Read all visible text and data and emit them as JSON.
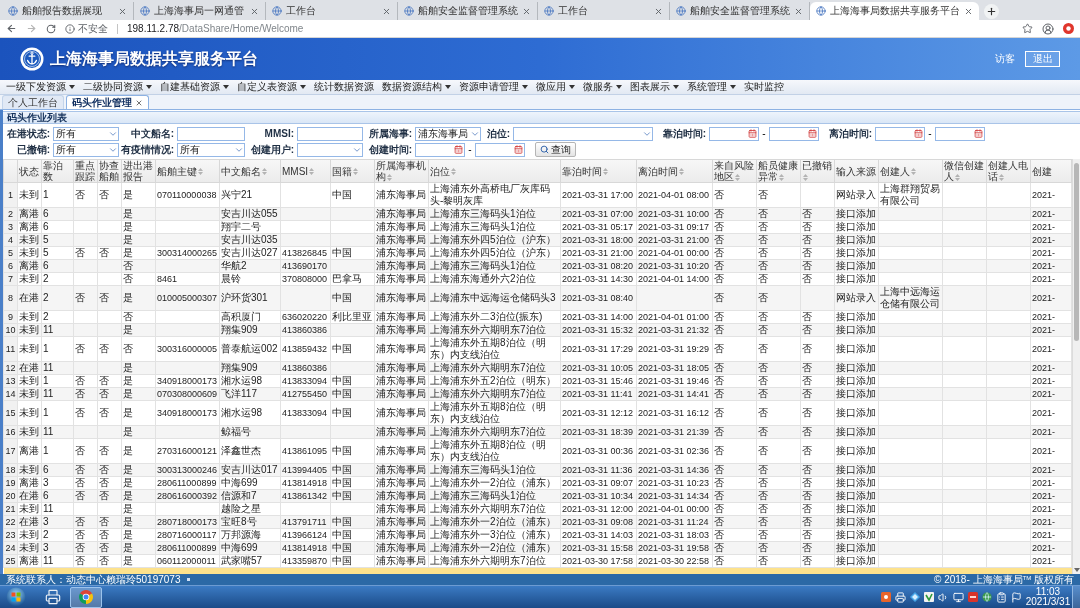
{
  "browser": {
    "tabs": [
      {
        "title": "船舶报告数据展现",
        "selected": false
      },
      {
        "title": "上海海事局一网通管",
        "selected": false
      },
      {
        "title": "工作台",
        "selected": false
      },
      {
        "title": "船舶安全监督管理系统",
        "selected": false
      },
      {
        "title": "工作台",
        "selected": false
      },
      {
        "title": "船舶安全监督管理系统",
        "selected": false
      },
      {
        "title": "上海海事局数据共享服务平台",
        "selected": true
      }
    ],
    "address": {
      "security": "不安全",
      "host": "198.11.2.78",
      "path": "/DataShare/Home/Welcome"
    }
  },
  "header": {
    "title": "上海海事局数据共享服务平台",
    "user": "访客",
    "logout": "退出"
  },
  "menu": [
    {
      "label": "一级下发资源",
      "dropdown": true
    },
    {
      "label": "二级协同资源",
      "dropdown": true
    },
    {
      "label": "自建基础资源",
      "dropdown": true
    },
    {
      "label": "自定义表资源",
      "dropdown": true
    },
    {
      "label": "统计数据资源",
      "dropdown": false
    },
    {
      "label": "数据资源结构",
      "dropdown": true
    },
    {
      "label": "资源申请管理",
      "dropdown": true
    },
    {
      "label": "微应用",
      "dropdown": true
    },
    {
      "label": "微服务",
      "dropdown": true
    },
    {
      "label": "图表展示",
      "dropdown": true
    },
    {
      "label": "系统管理",
      "dropdown": true
    },
    {
      "label": "实时监控",
      "dropdown": false
    }
  ],
  "page_tabs": [
    {
      "label": "个人工作台",
      "selected": false,
      "closable": false
    },
    {
      "label": "码头作业管理",
      "selected": true,
      "closable": true
    }
  ],
  "panel": {
    "title": "码头作业列表",
    "filters": [
      [
        {
          "label": "在港状态:",
          "kind": "select",
          "value": "所有"
        },
        {
          "label": "中文船名:",
          "kind": "text"
        },
        {
          "label": "MMSI:",
          "kind": "text"
        },
        {
          "label": "所属海事:",
          "kind": "select",
          "value": "浦东海事局"
        },
        {
          "label": "泊位:",
          "kind": "select"
        },
        {
          "label": "靠泊时间:",
          "kind": "date_range",
          "separator": "-"
        },
        {
          "label": "离泊时间:",
          "kind": "date_range",
          "separator": "-"
        }
      ],
      [
        {
          "label": "已撤销:",
          "kind": "select",
          "value": "所有"
        },
        {
          "label": "有疫情情况:",
          "kind": "select",
          "value": "所有"
        },
        {
          "label": "创建用户:",
          "kind": "select"
        },
        {
          "label": "创建时间:",
          "kind": "date_range",
          "separator": "-"
        },
        {
          "label": "查询",
          "kind": "button"
        }
      ]
    ],
    "table": {
      "columns": [
        {
          "label": "状态",
          "sortable": false,
          "kind": "text"
        },
        {
          "label": "靠泊数",
          "sortable": false,
          "kind": "text"
        },
        {
          "label": "重点跟踪",
          "sortable": false,
          "kind": "text"
        },
        {
          "label": "协查船舶",
          "sortable": false,
          "kind": "text"
        },
        {
          "label": "进出港报告",
          "sortable": false,
          "kind": "text"
        },
        {
          "label": "船舶主键",
          "sortable": true,
          "kind": "number"
        },
        {
          "label": "中文船名",
          "sortable": true,
          "kind": "text"
        },
        {
          "label": "MMSI",
          "sortable": true,
          "kind": "number"
        },
        {
          "label": "国籍",
          "sortable": true,
          "kind": "text"
        },
        {
          "label": "所属海事机构",
          "sortable": true,
          "kind": "text"
        },
        {
          "label": "泊位",
          "sortable": true,
          "kind": "text"
        },
        {
          "label": "靠泊时间",
          "sortable": true,
          "kind": "number"
        },
        {
          "label": "离泊时间",
          "sortable": true,
          "kind": "number"
        },
        {
          "label": "来自风险地区",
          "sortable": true,
          "kind": "text"
        },
        {
          "label": "船员健康异常",
          "sortable": true,
          "kind": "text"
        },
        {
          "label": "已撤销",
          "sortable": true,
          "kind": "text"
        },
        {
          "label": "输入来源",
          "sortable": false,
          "kind": "text"
        },
        {
          "label": "创建人",
          "sortable": true,
          "kind": "text"
        },
        {
          "label": "微信创建人",
          "sortable": true,
          "kind": "text"
        },
        {
          "label": "创建人电话",
          "sortable": true,
          "kind": "text"
        },
        {
          "label": "创建",
          "sortable": false,
          "kind": "number"
        }
      ],
      "rows": [
        {
          "number": "1",
          "selected": false,
          "cells": [
            "未到",
            "1",
            "否",
            "否",
            "是",
            "070110000038",
            "兴宁21",
            null,
            "中国",
            "浦东海事局",
            "上海浦东外高桥电厂灰库码头-黎明灰库",
            "2021-03-31 17:00",
            "2021-04-01 08:00",
            "否",
            "否",
            null,
            "网站录入",
            "上海群翔贸易有限公司",
            null,
            null,
            "2021-"
          ]
        },
        {
          "number": "2",
          "selected": false,
          "cells": [
            "离港",
            "6",
            null,
            null,
            "是",
            null,
            "安吉川达055",
            null,
            null,
            "浦东海事局",
            "上海浦东三海码头1泊位",
            "2021-03-31 07:00",
            "2021-03-31 10:00",
            "否",
            "否",
            "否",
            "接口添加",
            null,
            null,
            null,
            "2021-"
          ]
        },
        {
          "number": "3",
          "selected": false,
          "cells": [
            "离港",
            "6",
            null,
            null,
            "是",
            null,
            "翔宇二号",
            null,
            null,
            "浦东海事局",
            "上海浦东三海码头1泊位",
            "2021-03-31 05:17",
            "2021-03-31 09:17",
            "否",
            "否",
            "否",
            "接口添加",
            null,
            null,
            null,
            "2021-"
          ]
        },
        {
          "number": "4",
          "selected": false,
          "cells": [
            "未到",
            "5",
            null,
            null,
            "是",
            null,
            "安吉川达035",
            null,
            null,
            "浦东海事局",
            "上海浦东外四5泊位（沪东）",
            "2021-03-31 18:00",
            "2021-03-31 21:00",
            "否",
            "否",
            "否",
            "接口添加",
            null,
            null,
            null,
            "2021-"
          ]
        },
        {
          "number": "5",
          "selected": false,
          "cells": [
            "未到",
            "5",
            "否",
            "否",
            "是",
            "300314000265",
            "安吉川达027",
            "413826845",
            "中国",
            "浦东海事局",
            "上海浦东外四5泊位（沪东）",
            "2021-03-31 21:00",
            "2021-04-01 00:00",
            "否",
            "否",
            "否",
            "接口添加",
            null,
            null,
            null,
            "2021-"
          ]
        },
        {
          "number": "6",
          "selected": false,
          "cells": [
            "离港",
            "6",
            null,
            null,
            "否",
            null,
            "华航2",
            "413690170",
            null,
            "浦东海事局",
            "上海浦东三海码头1泊位",
            "2021-03-31 08:20",
            "2021-03-31 10:20",
            "否",
            "否",
            "否",
            "接口添加",
            null,
            null,
            null,
            "2021-"
          ]
        },
        {
          "number": "7",
          "selected": false,
          "cells": [
            "未到",
            "2",
            null,
            null,
            "否",
            "8461",
            "晨铃",
            "370808000",
            "巴拿马",
            "浦东海事局",
            "上海浦东海通外六2泊位",
            "2021-03-31 14:30",
            "2021-04-01 14:00",
            "否",
            "否",
            "否",
            "接口添加",
            null,
            null,
            null,
            "2021-"
          ]
        },
        {
          "number": "8",
          "selected": false,
          "cells": [
            "在港",
            "2",
            "否",
            "否",
            "是",
            "010005000307",
            "沪环货301",
            null,
            "中国",
            "浦东海事局",
            "上海浦东中远海运仓储码头3",
            "2021-03-31 08:40",
            null,
            "否",
            "否",
            null,
            "网站录入",
            "上海中远海运仓储有限公司",
            null,
            null,
            "2021-"
          ]
        },
        {
          "number": "9",
          "selected": false,
          "cells": [
            "未到",
            "2",
            null,
            null,
            "否",
            null,
            "高积厦门",
            "636020220",
            "利比里亚",
            "浦东海事局",
            "上海浦东外二3泊位(振东)",
            "2021-03-31 14:00",
            "2021-04-01 01:00",
            "否",
            "否",
            "否",
            "接口添加",
            null,
            null,
            null,
            "2021-"
          ]
        },
        {
          "number": "10",
          "selected": false,
          "cells": [
            "未到",
            "11",
            null,
            null,
            "是",
            null,
            "翔集909",
            "413860386",
            null,
            "浦东海事局",
            "上海浦东外六期明东7泊位",
            "2021-03-31 15:32",
            "2021-03-31 21:32",
            "否",
            "否",
            "否",
            "接口添加",
            null,
            null,
            null,
            "2021-"
          ]
        },
        {
          "number": "11",
          "selected": false,
          "cells": [
            "未到",
            "1",
            "否",
            "否",
            "否",
            "300316000005",
            "普泰航运002",
            "413859432",
            "中国",
            "浦东海事局",
            "上海浦东外五期8泊位（明东）内支线泊位",
            "2021-03-31 17:29",
            "2021-03-31 19:29",
            "否",
            "否",
            "否",
            "接口添加",
            null,
            null,
            null,
            "2021-"
          ]
        },
        {
          "number": "12",
          "selected": false,
          "cells": [
            "在港",
            "11",
            null,
            null,
            "是",
            null,
            "翔集909",
            "413860386",
            null,
            "浦东海事局",
            "上海浦东外六期明东7泊位",
            "2021-03-31 10:05",
            "2021-03-31 18:05",
            "否",
            "否",
            "否",
            "接口添加",
            null,
            null,
            null,
            "2021-"
          ]
        },
        {
          "number": "13",
          "selected": false,
          "cells": [
            "未到",
            "1",
            "否",
            "否",
            "是",
            "340918000173",
            "湘水运98",
            "413833094",
            "中国",
            "浦东海事局",
            "上海浦东外五2泊位（明东）",
            "2021-03-31 15:46",
            "2021-03-31 19:46",
            "否",
            "否",
            "否",
            "接口添加",
            null,
            null,
            null,
            "2021-"
          ]
        },
        {
          "number": "14",
          "selected": false,
          "cells": [
            "未到",
            "11",
            "否",
            "否",
            "是",
            "070308000609",
            "飞洋117",
            "412755450",
            "中国",
            "浦东海事局",
            "上海浦东外六期明东7泊位",
            "2021-03-31 11:41",
            "2021-03-31 14:41",
            "否",
            "否",
            "否",
            "接口添加",
            null,
            null,
            null,
            "2021-"
          ]
        },
        {
          "number": "15",
          "selected": false,
          "cells": [
            "未到",
            "1",
            "否",
            "否",
            "是",
            "340918000173",
            "湘水运98",
            "413833094",
            "中国",
            "浦东海事局",
            "上海浦东外五期8泊位（明东）内支线泊位",
            "2021-03-31 12:12",
            "2021-03-31 16:12",
            "否",
            "否",
            "否",
            "接口添加",
            null,
            null,
            null,
            "2021-"
          ]
        },
        {
          "number": "16",
          "selected": false,
          "cells": [
            "未到",
            "11",
            null,
            null,
            "是",
            null,
            "鲸福号",
            null,
            null,
            "浦东海事局",
            "上海浦东外六期明东7泊位",
            "2021-03-31 18:39",
            "2021-03-31 21:39",
            "否",
            "否",
            "否",
            "接口添加",
            null,
            null,
            null,
            "2021-"
          ]
        },
        {
          "number": "17",
          "selected": false,
          "cells": [
            "离港",
            "1",
            "否",
            "否",
            "是",
            "270316000121",
            "泽鑫世杰",
            "413861095",
            "中国",
            "浦东海事局",
            "上海浦东外五期8泊位（明东）内支线泊位",
            "2021-03-31 00:36",
            "2021-03-31 02:36",
            "否",
            "否",
            "否",
            "接口添加",
            null,
            null,
            null,
            "2021-"
          ]
        },
        {
          "number": "18",
          "selected": false,
          "cells": [
            "未到",
            "6",
            "否",
            "否",
            "是",
            "300313000246",
            "安吉川达017",
            "413994405",
            "中国",
            "浦东海事局",
            "上海浦东三海码头1泊位",
            "2021-03-31 11:36",
            "2021-03-31 14:36",
            "否",
            "否",
            "否",
            "接口添加",
            null,
            null,
            null,
            "2021-"
          ]
        },
        {
          "number": "19",
          "selected": false,
          "cells": [
            "离港",
            "3",
            "否",
            "否",
            "是",
            "280611000899",
            "中海699",
            "413814918",
            "中国",
            "浦东海事局",
            "上海浦东外一2泊位（浦东）",
            "2021-03-31 09:07",
            "2021-03-31 10:23",
            "否",
            "否",
            "否",
            "接口添加",
            null,
            null,
            null,
            "2021-"
          ]
        },
        {
          "number": "20",
          "selected": false,
          "cells": [
            "在港",
            "6",
            "否",
            "否",
            "是",
            "280616000392",
            "信源和7",
            "413861342",
            "中国",
            "浦东海事局",
            "上海浦东三海码头1泊位",
            "2021-03-31 10:34",
            "2021-03-31 14:34",
            "否",
            "否",
            "否",
            "接口添加",
            null,
            null,
            null,
            "2021-"
          ]
        },
        {
          "number": "21",
          "selected": false,
          "cells": [
            "未到",
            "11",
            null,
            null,
            "是",
            null,
            "越险之星",
            null,
            null,
            "浦东海事局",
            "上海浦东外六期明东7泊位",
            "2021-03-31 12:00",
            "2021-04-01 00:00",
            "否",
            "否",
            "否",
            "接口添加",
            null,
            null,
            null,
            "2021-"
          ]
        },
        {
          "number": "22",
          "selected": false,
          "cells": [
            "在港",
            "3",
            "否",
            "否",
            "是",
            "280718000173",
            "宝旺8号",
            "413791711",
            "中国",
            "浦东海事局",
            "上海浦东外一2泊位（浦东）",
            "2021-03-31 09:08",
            "2021-03-31 11:24",
            "否",
            "否",
            "否",
            "接口添加",
            null,
            null,
            null,
            "2021-"
          ]
        },
        {
          "number": "23",
          "selected": false,
          "cells": [
            "未到",
            "2",
            "否",
            "否",
            "是",
            "280716000117",
            "万邦源海",
            "413966124",
            "中国",
            "浦东海事局",
            "上海浦东外一3泊位（浦东）",
            "2021-03-31 14:03",
            "2021-03-31 18:03",
            "否",
            "否",
            "否",
            "接口添加",
            null,
            null,
            null,
            "2021-"
          ]
        },
        {
          "number": "24",
          "selected": false,
          "cells": [
            "未到",
            "3",
            "否",
            "否",
            "是",
            "280611000899",
            "中海699",
            "413814918",
            "中国",
            "浦东海事局",
            "上海浦东外一2泊位（浦东）",
            "2021-03-31 15:58",
            "2021-03-31 19:58",
            "否",
            "否",
            "否",
            "接口添加",
            null,
            null,
            null,
            "2021-"
          ]
        },
        {
          "number": "25",
          "selected": false,
          "cells": [
            "离港",
            "11",
            "否",
            "否",
            "是",
            "060112000011",
            "武家嘴57",
            "413359870",
            "中国",
            "浦东海事局",
            "上海浦东外六期明东7泊位",
            "2021-03-30 17:58",
            "2021-03-30 22:58",
            "否",
            "否",
            "否",
            "接口添加",
            null,
            null,
            null,
            "2021-"
          ]
        },
        {
          "selected": true
        }
      ]
    }
  },
  "status_bar": {
    "contact": "系统联系人：动态中心赖瑞玲50197073",
    "copyright": "© 2018- 上海海事局$^{TM}$ 版权所有"
  },
  "taskbar": {
    "clock": {
      "time": "11:03",
      "date": "2021/3/31"
    }
  }
}
